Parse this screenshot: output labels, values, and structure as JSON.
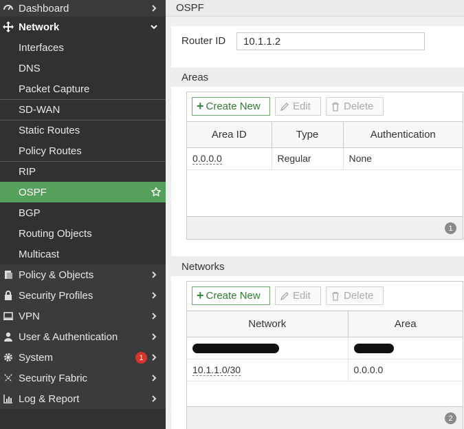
{
  "sidebar": {
    "items": [
      {
        "label": "Dashboard",
        "type": "top",
        "icon": "dashboard-icon"
      },
      {
        "label": "Network",
        "type": "top-open",
        "icon": "network-icon"
      },
      {
        "label": "Interfaces",
        "type": "sub"
      },
      {
        "label": "DNS",
        "type": "sub"
      },
      {
        "label": "Packet Capture",
        "type": "sub"
      },
      {
        "label": "SD-WAN",
        "type": "sub"
      },
      {
        "label": "Static Routes",
        "type": "sub"
      },
      {
        "label": "Policy Routes",
        "type": "sub"
      },
      {
        "label": "RIP",
        "type": "sub"
      },
      {
        "label": "OSPF",
        "type": "sub-active"
      },
      {
        "label": "BGP",
        "type": "sub"
      },
      {
        "label": "Routing Objects",
        "type": "sub"
      },
      {
        "label": "Multicast",
        "type": "sub"
      },
      {
        "label": "Policy & Objects",
        "type": "top",
        "icon": "policy-icon"
      },
      {
        "label": "Security Profiles",
        "type": "top",
        "icon": "lock-icon"
      },
      {
        "label": "VPN",
        "type": "top",
        "icon": "monitor-icon"
      },
      {
        "label": "User & Authentication",
        "type": "top",
        "icon": "user-icon"
      },
      {
        "label": "System",
        "type": "top",
        "icon": "gear-icon",
        "badge": "1"
      },
      {
        "label": "Security Fabric",
        "type": "top",
        "icon": "fabric-icon"
      },
      {
        "label": "Log & Report",
        "type": "top",
        "icon": "chart-icon"
      }
    ]
  },
  "page": {
    "title": "OSPF",
    "router_id_label": "Router ID",
    "router_id_value": "10.1.1.2"
  },
  "areas": {
    "title": "Areas",
    "create_label": "Create New",
    "edit_label": "Edit",
    "delete_label": "Delete",
    "columns": [
      "Area ID",
      "Type",
      "Authentication"
    ],
    "rows": [
      {
        "area_id": "0.0.0.0",
        "type": "Regular",
        "authentication": "None"
      }
    ],
    "count": "1"
  },
  "networks": {
    "title": "Networks",
    "create_label": "Create New",
    "edit_label": "Edit",
    "delete_label": "Delete",
    "columns": [
      "Network",
      "Area"
    ],
    "rows": [
      {
        "network": "10.1.1.0/30",
        "area": "0.0.0.0"
      }
    ],
    "count": "2"
  },
  "colors": {
    "sidebar_bg": "#313131",
    "active_green": "#55a05a",
    "badge_red": "#d9342b"
  }
}
